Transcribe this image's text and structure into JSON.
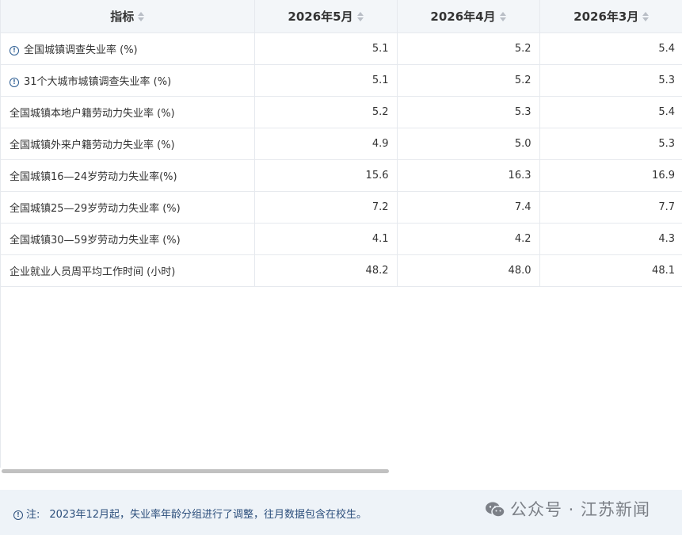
{
  "table": {
    "columns": [
      "指标",
      "2026年5月",
      "2026年4月",
      "2026年3月"
    ],
    "rows": [
      {
        "label": "全国城镇调查失业率 (%)",
        "has_info": true,
        "values": [
          "5.1",
          "5.2",
          "5.4"
        ]
      },
      {
        "label": "31个大城市城镇调查失业率 (%)",
        "has_info": true,
        "values": [
          "5.1",
          "5.2",
          "5.3"
        ]
      },
      {
        "label": "全国城镇本地户籍劳动力失业率 (%)",
        "has_info": false,
        "values": [
          "5.2",
          "5.3",
          "5.4"
        ]
      },
      {
        "label": "全国城镇外来户籍劳动力失业率 (%)",
        "has_info": false,
        "values": [
          "4.9",
          "5.0",
          "5.3"
        ]
      },
      {
        "label": "全国城镇16—24岁劳动力失业率(%)",
        "has_info": false,
        "values": [
          "15.6",
          "16.3",
          "16.9"
        ]
      },
      {
        "label": "全国城镇25—29岁劳动力失业率 (%)",
        "has_info": false,
        "values": [
          "7.2",
          "7.4",
          "7.7"
        ]
      },
      {
        "label": "全国城镇30—59岁劳动力失业率 (%)",
        "has_info": false,
        "values": [
          "4.1",
          "4.2",
          "4.3"
        ]
      },
      {
        "label": "企业就业人员周平均工作时间 (小时)",
        "has_info": false,
        "values": [
          "48.2",
          "48.0",
          "48.1"
        ]
      }
    ],
    "scrollbar_position": 0
  },
  "footer": {
    "note_label": "注:",
    "note_text": "2023年12月起，失业率年龄分组进行了调整，往月数据包含在校生。",
    "watermark": "公众号 · 江苏新闻"
  },
  "colors": {
    "header_bg": "#f3f6f9",
    "border": "#e6e9ee",
    "note_text": "#2c4f7c",
    "footer_bg": "#eef3f8"
  },
  "icons": {
    "sort": "sort-icon",
    "info": "info-icon",
    "wechat": "wechat-icon"
  }
}
